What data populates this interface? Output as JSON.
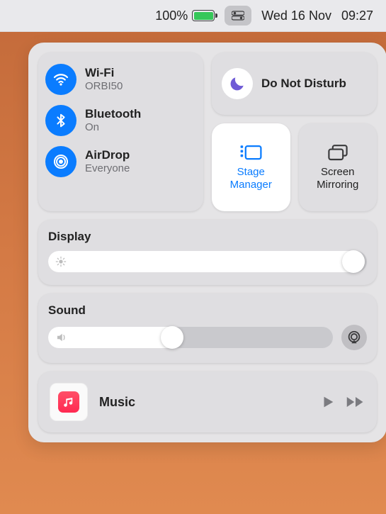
{
  "menubar": {
    "battery_percent": "100%",
    "date_text": "Wed 16 Nov",
    "time_text": "09:27"
  },
  "connectivity": {
    "wifi": {
      "title": "Wi-Fi",
      "status": "ORBI50"
    },
    "bluetooth": {
      "title": "Bluetooth",
      "status": "On"
    },
    "airdrop": {
      "title": "AirDrop",
      "status": "Everyone"
    }
  },
  "focus": {
    "dnd_title": "Do Not Disturb"
  },
  "tiles": {
    "stage_manager": "Stage Manager",
    "screen_mirroring": "Screen Mirroring"
  },
  "display": {
    "title": "Display",
    "value_percent": 97
  },
  "sound": {
    "title": "Sound",
    "value_percent": 45
  },
  "music": {
    "app": "Music"
  }
}
